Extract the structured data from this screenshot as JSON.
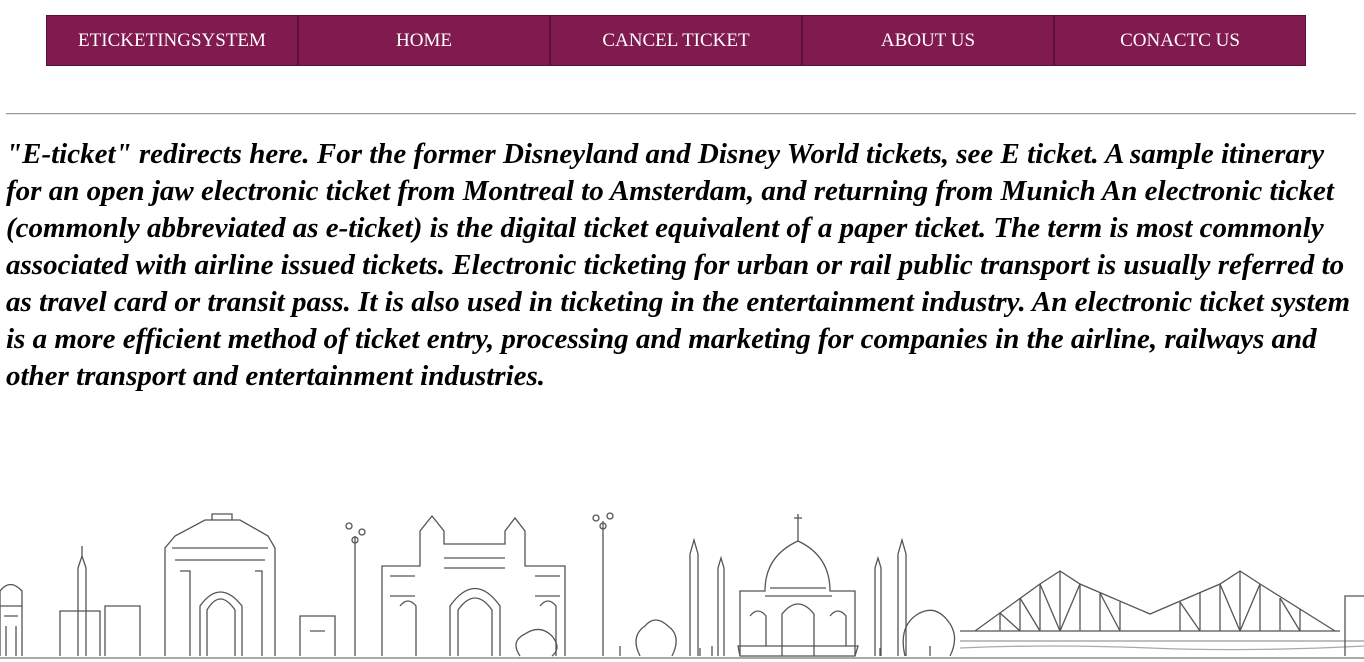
{
  "nav": {
    "items": [
      {
        "label": "ETICKETINGSYSTEM"
      },
      {
        "label": "HOME"
      },
      {
        "label": "CANCEL TICKET"
      },
      {
        "label": "ABOUT US"
      },
      {
        "label": "CONACTC US"
      }
    ]
  },
  "main": {
    "paragraph": "\"E-ticket\" redirects here. For the former Disneyland and Disney World tickets, see E ticket. A sample itinerary for an open jaw electronic ticket from Montreal to Amsterdam, and returning from Munich An electronic ticket (commonly abbreviated as e-ticket) is the digital ticket equivalent of a paper ticket. The term is most commonly associated with airline issued tickets. Electronic ticketing for urban or rail public transport is usually referred to as travel card or transit pass. It is also used in ticketing in the entertainment industry. An electronic ticket system is a more efficient method of ticket entry, processing and marketing for companies in the airline, railways and other transport and entertainment industries."
  },
  "theme": {
    "nav_bg": "#811a4e",
    "nav_text": "#ffffff"
  }
}
